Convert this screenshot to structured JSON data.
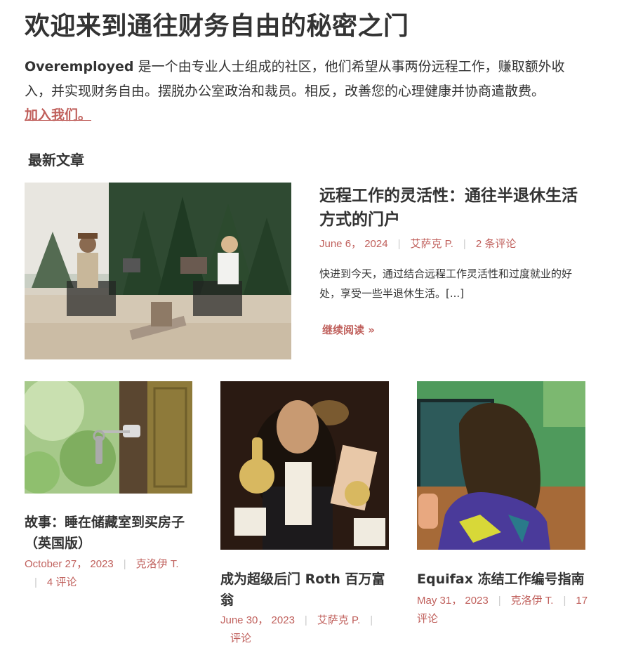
{
  "hero": {
    "title": "欢迎来到通往财务自由的秘密之门",
    "intro_brand": "Overemployed",
    "intro_text": " 是一个由专业人士组成的社区，他们希望从事两份远程工作，赚取额外收入，并实现财务自由。摆脱办公室政治和裁员。相反，改善您的心理健康并协商遣散费。",
    "join_link": "加入我们。"
  },
  "section": {
    "heading": "最新文章"
  },
  "featured": {
    "title": "远程工作的灵活性：通往半退休生活方式的门户",
    "date": "June 6， 2024",
    "author": "艾萨克 P.",
    "comments": "2 条评论",
    "excerpt": "快进到今天，通过结合远程工作灵活性和过度就业的好处，享受一些半退休生活。[...]",
    "read_more": "继续阅读 »"
  },
  "posts": [
    {
      "title": "故事：睡在储藏室到买房子（英国版）",
      "date": "October 27， 2023",
      "author": "克洛伊 T.",
      "comments": "4 评论"
    },
    {
      "title": "成为超级后门 Roth 百万富翁",
      "date": "June 30， 2023",
      "author": "艾萨克 P.",
      "comments": "评论"
    },
    {
      "title": "Equifax 冻结工作编号指南",
      "date": "May 31， 2023",
      "author": "克洛伊 T.",
      "comments": "17 评论"
    }
  ],
  "colors": {
    "accent": "#c0605c",
    "text": "#333333",
    "separator": "#cccccc"
  },
  "icons": {
    "featured_image": "camping-laptops-image",
    "post1_image": "door-key-image",
    "post2_image": "thumbs-up-portrait-image",
    "post3_image": "woman-painting-image"
  }
}
